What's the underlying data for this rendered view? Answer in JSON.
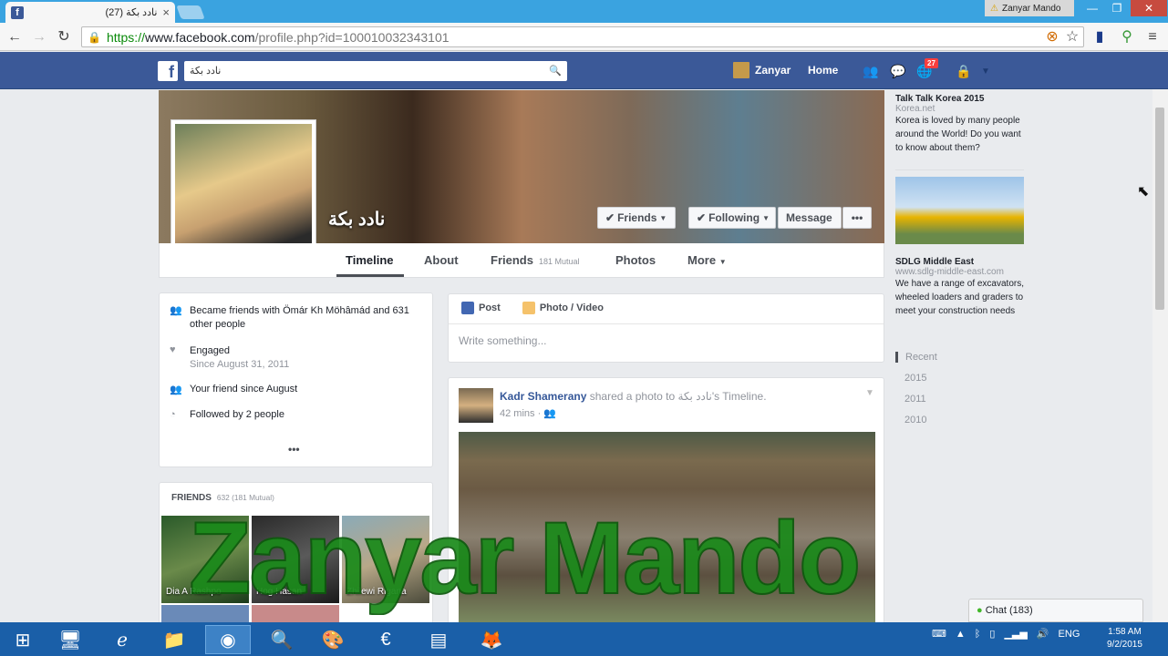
{
  "browser": {
    "tab_title": "(27) نادد بکة",
    "tab_close": "×",
    "user_badge": "Zanyar Mando",
    "url_https": "https://",
    "url_host": "www.facebook.com",
    "url_rest": "/profile.php?id=100010032343101"
  },
  "fb": {
    "search_value": "نادد بکة",
    "user_name": "Zanyar",
    "home_label": "Home",
    "notification_count": "27"
  },
  "profile": {
    "name": "نادد بکة",
    "buttons": {
      "friends": "Friends",
      "following": "Following",
      "message": "Message",
      "more": "•••"
    },
    "tabs": {
      "timeline": "Timeline",
      "about": "About",
      "friends": "Friends",
      "friends_mutual": "181 Mutual",
      "photos": "Photos",
      "more": "More"
    }
  },
  "intro": {
    "row1": "Became friends with Ömár Kh Möhâmád and 631 other people",
    "row2": "Engaged",
    "row2_sub": "Since August 31, 2011",
    "row3": "Your friend since August",
    "row4": "Followed by 2 people",
    "dots": "•••"
  },
  "friends_card": {
    "heading": "FRIENDS",
    "count": "632 (181 Mutual)",
    "thumbs": [
      {
        "name": "Dia A Rashpo"
      },
      {
        "name": "Hog Hasan"
      },
      {
        "name": "Zhilewi Rigana"
      }
    ]
  },
  "composer": {
    "post_label": "Post",
    "photo_label": "Photo / Video",
    "placeholder": "Write something..."
  },
  "post": {
    "author": "Kadr Shamerany",
    "shared_text": "shared a photo to",
    "target": "نادد بکة's Timeline.",
    "time": "42 mins"
  },
  "ads": [
    {
      "title": "Talk Talk Korea 2015",
      "url": "Korea.net",
      "body": "Korea is loved by many people around the World! Do you want to know about them?"
    },
    {
      "title": "SDLG Middle East",
      "url": "www.sdlg-middle-east.com",
      "body": "We have a range of excavators, wheeled loaders and graders to meet your construction needs"
    }
  ],
  "years": [
    "Recent",
    "2015",
    "2011",
    "2010"
  ],
  "chat_label": "Chat (183)",
  "watermark": "Zanyar Mando",
  "taskbar": {
    "lang": "ENG",
    "time": "1:58 AM",
    "date": "9/2/2015"
  },
  "colors": {
    "fb_blue": "#3b5998",
    "link_blue": "#365899",
    "watermark_green": "#1a8a1a",
    "taskbar": "#1a5fa8"
  }
}
